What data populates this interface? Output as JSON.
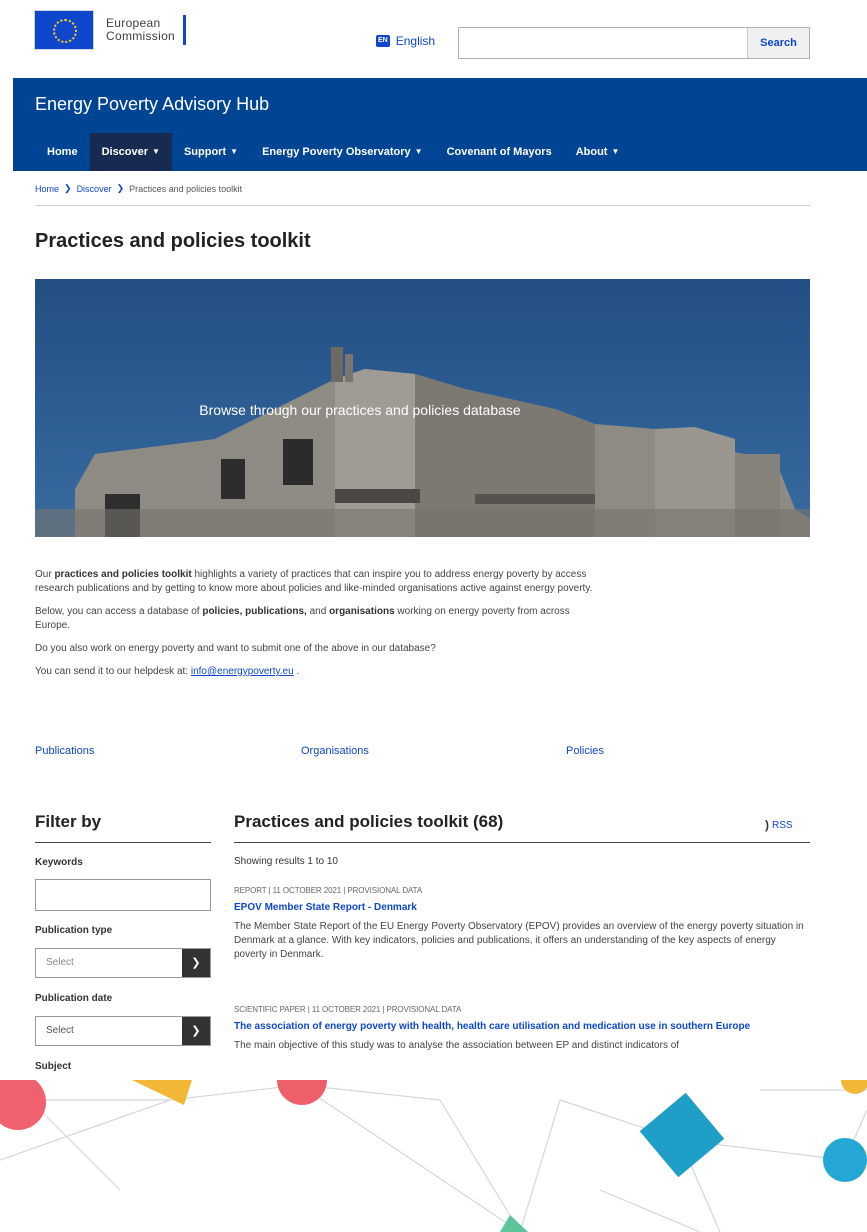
{
  "topbar": {
    "logo_line1": "European",
    "logo_line2": "Commission",
    "language_badge": "EN",
    "language": "English",
    "search_value": "",
    "search_button": "Search"
  },
  "header": {
    "site_title": "Energy Poverty Advisory Hub",
    "nav": [
      {
        "label": "Home"
      },
      {
        "label": "Discover"
      },
      {
        "label": "Support"
      },
      {
        "label": "Energy Poverty Observatory"
      },
      {
        "label": "Covenant of Mayors"
      },
      {
        "label": "About"
      }
    ]
  },
  "breadcrumb": {
    "items": [
      "Home",
      "Discover",
      "Practices and policies toolkit"
    ]
  },
  "page_title": "Practices and policies toolkit",
  "hero": {
    "caption": "Browse through our practices and policies database"
  },
  "intro": {
    "p1_a": "Our ",
    "p1_bold": "practices and policies toolkit",
    "p1_b": " highlights a variety of practices that can inspire you to address energy poverty by access research publications and by getting to know more about policies and like-minded organisations active against energy poverty.",
    "p2_a": "Below, you can access a database of ",
    "p2_bold1": "policies, publications,",
    "p2_b": " and ",
    "p2_bold2": "organisations",
    "p2_c": " working on energy poverty from across Europe.",
    "p3": "Do you also work on energy poverty and want to submit one of the above in our database?",
    "p4_a": "You can send it to our helpdesk at: ",
    "p4_link": "info@energypoverty.eu",
    "p4_b": " ."
  },
  "quick_links": [
    "Publications",
    "Organisations",
    "Policies"
  ],
  "filter": {
    "title": "Filter by",
    "keywords_label": "Keywords",
    "keywords_value": "",
    "publication_type_label": "Publication type",
    "publication_type_value": "Select",
    "publication_date_label": "Publication date",
    "publication_date_value": "Select",
    "subject_label": "Subject"
  },
  "results": {
    "title": "Practices and policies toolkit (68)",
    "rss": "RSS",
    "showing": "Showing results 1 to 10",
    "items": [
      {
        "meta": "REPORT | 11 OCTOBER 2021 | PROVISIONAL DATA",
        "title": "EPOV Member State Report - Denmark",
        "desc": "The Member State Report of the EU Energy Poverty Observatory (EPOV) provides an overview of the energy poverty situation in Denmark at a glance. With key indicators, policies and publications, it offers an understanding of the key aspects of energy poverty in Denmark."
      },
      {
        "meta": "SCIENTIFIC PAPER | 11 OCTOBER 2021 | PROVISIONAL DATA",
        "title": "The association of energy poverty with health, health care utilisation and medication use in southern Europe",
        "desc": "The main objective of this study was to analyse the association between EP and distinct indicators of"
      }
    ]
  },
  "colors": {
    "brand_blue": "#004494",
    "link_blue": "#0e47cb",
    "active_nav": "#172b52"
  }
}
